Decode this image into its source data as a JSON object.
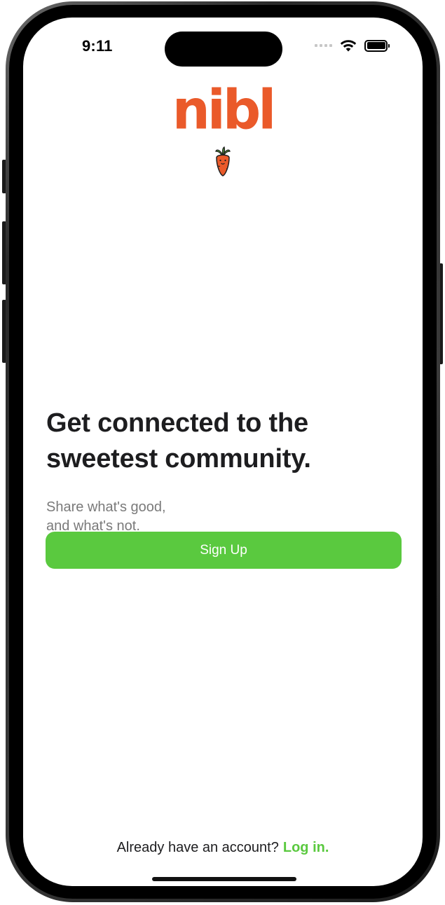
{
  "status_bar": {
    "time": "9:11",
    "icons": [
      "cellular-signal-icon",
      "wifi-icon",
      "battery-icon"
    ]
  },
  "brand": {
    "logo_text": "nibl",
    "logo_color": "#ea5a2a",
    "mascot_icon": "carrot-icon"
  },
  "hero": {
    "headline_line1": "Get connected to the",
    "headline_line2": "sweetest community.",
    "subtext_line1": "Share what's good,",
    "subtext_line2": "and what's not."
  },
  "actions": {
    "signup_label": "Sign Up",
    "signup_color": "#5ac93f"
  },
  "footer": {
    "prompt": "Already have an account?",
    "login_label": "Log in.",
    "accent_color": "#5ac93f"
  }
}
